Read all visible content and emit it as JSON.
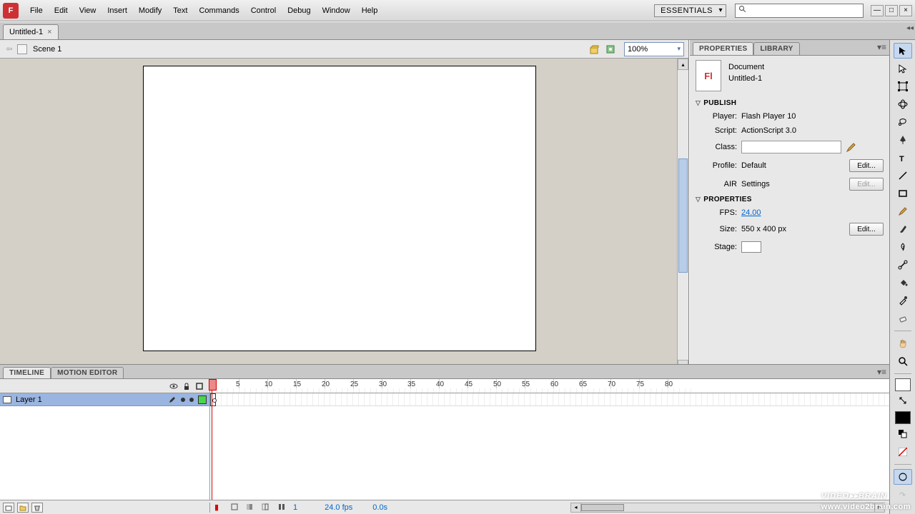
{
  "app": {
    "icon_letter": "F"
  },
  "menu": [
    "File",
    "Edit",
    "View",
    "Insert",
    "Modify",
    "Text",
    "Commands",
    "Control",
    "Debug",
    "Window",
    "Help"
  ],
  "workspace": "ESSENTIALS",
  "window_buttons": {
    "min": "—",
    "max": "□",
    "close": "×"
  },
  "doctab": {
    "title": "Untitled-1",
    "close": "×"
  },
  "scene": {
    "name": "Scene 1",
    "zoom": "100%"
  },
  "panels": {
    "tabs": {
      "properties": "PROPERTIES",
      "library": "LIBRARY"
    },
    "doc": {
      "icon": "Fl",
      "type": "Document",
      "name": "Untitled-1"
    },
    "publish": {
      "header": "PUBLISH",
      "player_label": "Player:",
      "player_value": "Flash Player 10",
      "script_label": "Script:",
      "script_value": "ActionScript 3.0",
      "class_label": "Class:",
      "class_value": "",
      "profile_label": "Profile:",
      "profile_value": "Default",
      "air_label": "AIR",
      "air_value": "Settings",
      "edit_btn": "Edit..."
    },
    "properties": {
      "header": "PROPERTIES",
      "fps_label": "FPS:",
      "fps_value": "24.00",
      "size_label": "Size:",
      "size_value": "550 x 400 px",
      "stage_label": "Stage:",
      "edit_btn": "Edit..."
    }
  },
  "timeline": {
    "tabs": {
      "timeline": "TIMELINE",
      "motion": "MOTION EDITOR"
    },
    "layer": "Layer 1",
    "ticks": [
      5,
      10,
      15,
      20,
      25,
      30,
      35,
      40,
      45,
      50,
      55,
      60,
      65,
      70,
      75,
      80
    ],
    "footer": {
      "frame": "1",
      "fps": "24.0 fps",
      "time": "0.0s"
    }
  },
  "watermark": {
    "main": "VIDEO▸▸BRAIN",
    "sub": "www.video2brain.com"
  }
}
